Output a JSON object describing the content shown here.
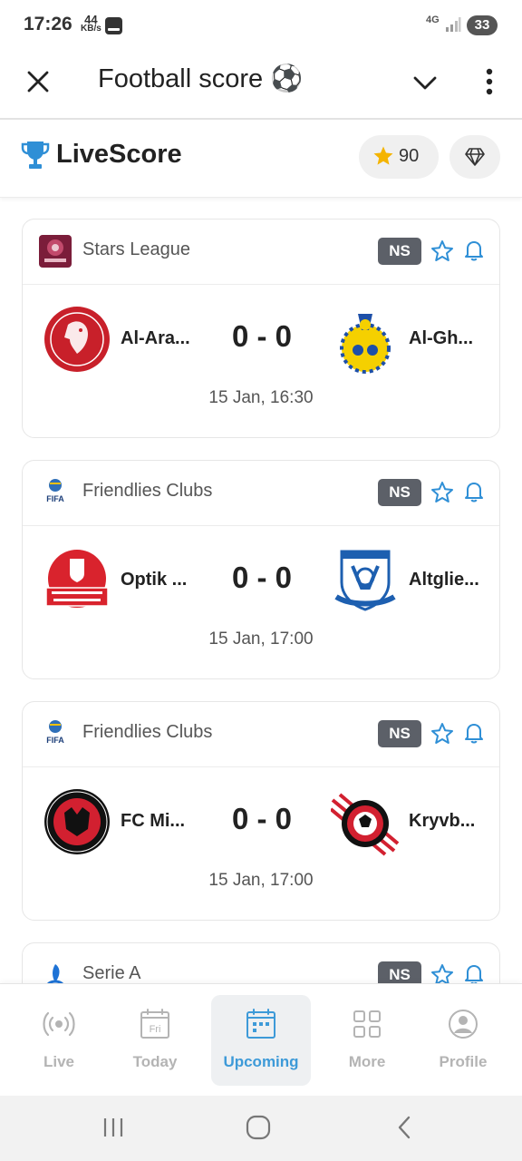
{
  "status_bar": {
    "time": "17:26",
    "speed_value": "44",
    "speed_unit": "KB/s",
    "network": "4G",
    "battery": "33"
  },
  "header": {
    "title": "Football score ⚽"
  },
  "livescore_bar": {
    "brand": "LiveScore",
    "coins": "90"
  },
  "matches": [
    {
      "league": "Stars League",
      "status": "NS",
      "home_team": "Al-Ara...",
      "away_team": "Al-Gh...",
      "score": "0 - 0",
      "kickoff": "15 Jan, 16:30"
    },
    {
      "league": "Friendlies Clubs",
      "status": "NS",
      "home_team": "Optik ...",
      "away_team": "Altglie...",
      "score": "0 - 0",
      "kickoff": "15 Jan, 17:00"
    },
    {
      "league": "Friendlies Clubs",
      "status": "NS",
      "home_team": "FC Mi...",
      "away_team": "Kryvb...",
      "score": "0 - 0",
      "kickoff": "15 Jan, 17:00"
    },
    {
      "league": "Serie A",
      "status": "NS"
    }
  ],
  "bottom_nav": {
    "items": [
      {
        "label": "Live",
        "icon": "live-broadcast-icon"
      },
      {
        "label": "Today",
        "icon": "calendar-fri-icon",
        "icon_text": "Fri"
      },
      {
        "label": "Upcoming",
        "icon": "calendar-upcoming-icon",
        "active": true
      },
      {
        "label": "More",
        "icon": "grid-icon"
      },
      {
        "label": "Profile",
        "icon": "user-icon"
      }
    ]
  },
  "colors": {
    "accent": "#3d9ad8",
    "badge_bg": "#5c6068",
    "gold": "#f4b400"
  }
}
